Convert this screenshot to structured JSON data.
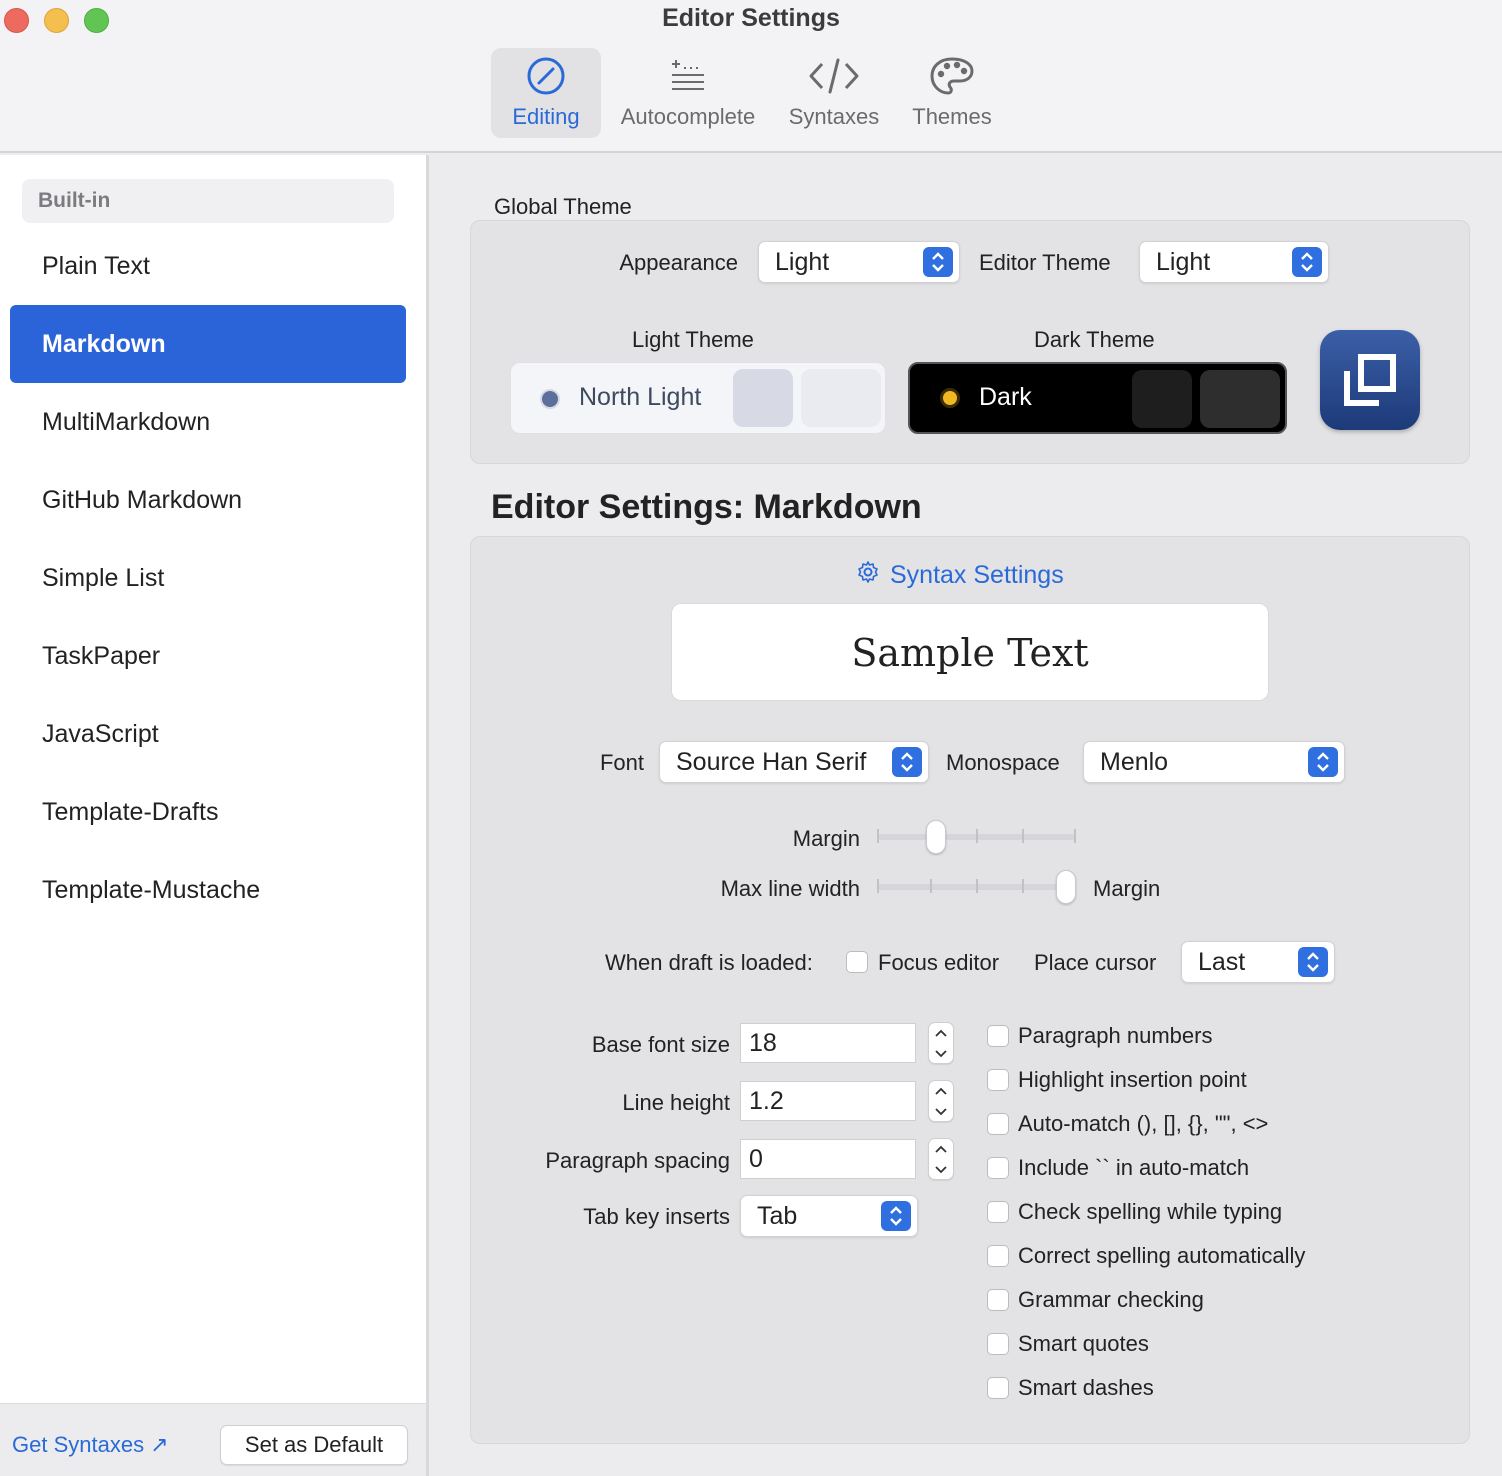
{
  "window": {
    "title": "Editor Settings"
  },
  "toolbar": {
    "tabs": [
      {
        "label": "Editing",
        "icon": "pencil-circle-icon",
        "active": true
      },
      {
        "label": "Autocomplete",
        "icon": "autocomplete-list-icon",
        "active": false
      },
      {
        "label": "Syntaxes",
        "icon": "code-brackets-icon",
        "active": false
      },
      {
        "label": "Themes",
        "icon": "palette-icon",
        "active": false
      }
    ]
  },
  "sidebar": {
    "section_header": "Built-in",
    "items": [
      {
        "label": "Plain Text"
      },
      {
        "label": "Markdown",
        "selected": true
      },
      {
        "label": "MultiMarkdown"
      },
      {
        "label": "GitHub Markdown"
      },
      {
        "label": "Simple List"
      },
      {
        "label": "TaskPaper"
      },
      {
        "label": "JavaScript"
      },
      {
        "label": "Template-Drafts"
      },
      {
        "label": "Template-Mustache"
      }
    ],
    "footer": {
      "get_syntaxes_label": "Get Syntaxes ↗",
      "set_default_label": "Set as Default"
    }
  },
  "global_theme": {
    "title": "Global Theme",
    "appearance_label": "Appearance",
    "appearance_value": "Light",
    "editor_theme_label": "Editor Theme",
    "editor_theme_value": "Light",
    "light_theme_label": "Light Theme",
    "light_theme_name": "North Light",
    "dark_theme_label": "Dark Theme",
    "dark_theme_name": "Dark",
    "colors": {
      "light_swatch_1": "#d7dae4",
      "light_swatch_2": "#e9ebf0",
      "light_dot": "#5c6f9c",
      "dark_swatch_1": "#1e1e1e",
      "dark_swatch_2": "#2e2e2e",
      "dark_dot": "#f2b824"
    }
  },
  "editor_settings": {
    "title": "Editor Settings: Markdown",
    "syntax_settings_link": "Syntax Settings",
    "sample_text": "Sample Text",
    "font_label": "Font",
    "font_value": "Source Han Serif",
    "monospace_label": "Monospace",
    "monospace_value": "Menlo",
    "margin_label": "Margin",
    "margin_level": 0.27,
    "max_line_width_label": "Max line width",
    "max_line_width_level": 1.0,
    "max_line_width_end_label": "Margin",
    "draft_loaded_label": "When draft is loaded:",
    "focus_editor_label": "Focus editor",
    "focus_editor_checked": false,
    "place_cursor_label": "Place cursor",
    "place_cursor_value": "Last",
    "base_font_size_label": "Base font size",
    "base_font_size_value": "18",
    "line_height_label": "Line height",
    "line_height_value": "1.2",
    "paragraph_spacing_label": "Paragraph spacing",
    "paragraph_spacing_value": "0",
    "tab_key_label": "Tab key inserts",
    "tab_key_value": "Tab",
    "checkboxes": [
      {
        "label": "Paragraph numbers",
        "checked": false
      },
      {
        "label": "Highlight insertion point",
        "checked": false
      },
      {
        "label": "Auto-match (), [], {}, \"\", <>",
        "checked": false
      },
      {
        "label": "Include `` in auto-match",
        "checked": false
      },
      {
        "label": "Check spelling while typing",
        "checked": false
      },
      {
        "label": "Correct spelling automatically",
        "checked": false
      },
      {
        "label": "Grammar checking",
        "checked": false
      },
      {
        "label": "Smart quotes",
        "checked": false
      },
      {
        "label": "Smart dashes",
        "checked": false
      }
    ]
  },
  "colors": {
    "accent": "#2b63d9",
    "link": "#2a6ad8"
  }
}
